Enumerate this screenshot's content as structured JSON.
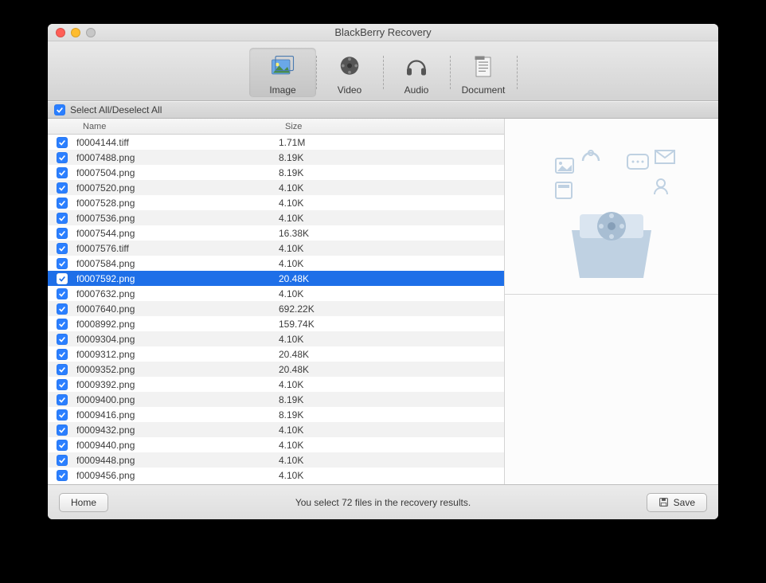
{
  "window": {
    "title": "BlackBerry Recovery"
  },
  "toolbar": {
    "tabs": [
      {
        "id": "image",
        "label": "Image",
        "selected": true
      },
      {
        "id": "video",
        "label": "Video"
      },
      {
        "id": "audio",
        "label": "Audio"
      },
      {
        "id": "document",
        "label": "Document"
      }
    ]
  },
  "selectAllLabel": "Select All/Deselect All",
  "columns": {
    "name": "Name",
    "size": "Size"
  },
  "files": [
    {
      "name": "f0004144.tiff",
      "size": "1.71M",
      "checked": true
    },
    {
      "name": "f0007488.png",
      "size": "8.19K",
      "checked": true
    },
    {
      "name": "f0007504.png",
      "size": "8.19K",
      "checked": true
    },
    {
      "name": "f0007520.png",
      "size": "4.10K",
      "checked": true
    },
    {
      "name": "f0007528.png",
      "size": "4.10K",
      "checked": true
    },
    {
      "name": "f0007536.png",
      "size": "4.10K",
      "checked": true
    },
    {
      "name": "f0007544.png",
      "size": "16.38K",
      "checked": true
    },
    {
      "name": "f0007576.tiff",
      "size": "4.10K",
      "checked": true
    },
    {
      "name": "f0007584.png",
      "size": "4.10K",
      "checked": true
    },
    {
      "name": "f0007592.png",
      "size": "20.48K",
      "checked": true,
      "selected": true
    },
    {
      "name": "f0007632.png",
      "size": "4.10K",
      "checked": true
    },
    {
      "name": "f0007640.png",
      "size": "692.22K",
      "checked": true
    },
    {
      "name": "f0008992.png",
      "size": "159.74K",
      "checked": true
    },
    {
      "name": "f0009304.png",
      "size": "4.10K",
      "checked": true
    },
    {
      "name": "f0009312.png",
      "size": "20.48K",
      "checked": true
    },
    {
      "name": "f0009352.png",
      "size": "20.48K",
      "checked": true
    },
    {
      "name": "f0009392.png",
      "size": "4.10K",
      "checked": true
    },
    {
      "name": "f0009400.png",
      "size": "8.19K",
      "checked": true
    },
    {
      "name": "f0009416.png",
      "size": "8.19K",
      "checked": true
    },
    {
      "name": "f0009432.png",
      "size": "4.10K",
      "checked": true
    },
    {
      "name": "f0009440.png",
      "size": "4.10K",
      "checked": true
    },
    {
      "name": "f0009448.png",
      "size": "4.10K",
      "checked": true
    },
    {
      "name": "f0009456.png",
      "size": "4.10K",
      "checked": true
    }
  ],
  "footer": {
    "home": "Home",
    "status": "You select 72 files in the recovery results.",
    "save": "Save"
  }
}
